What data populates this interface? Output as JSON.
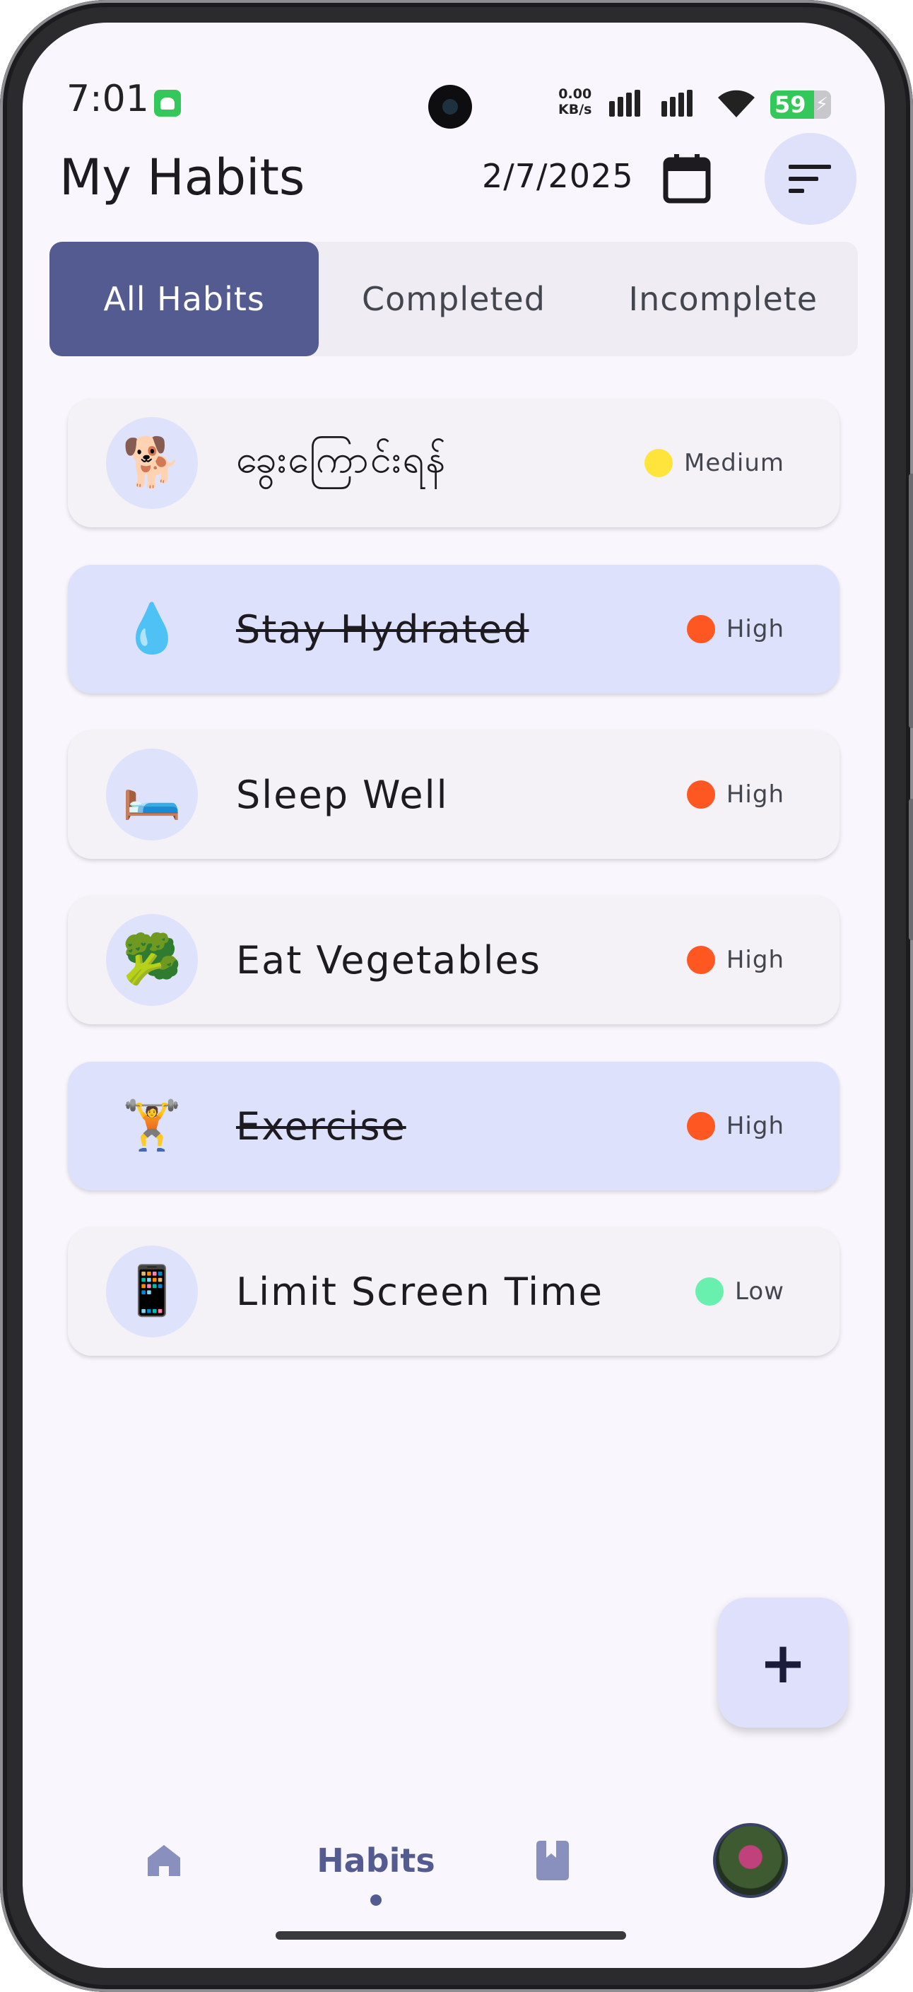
{
  "status_bar": {
    "time": "7:01",
    "net_speed_value": "0.00",
    "net_speed_unit": "KB/s",
    "battery": "59",
    "icons": [
      "android-icon",
      "signal-icon",
      "signal-icon",
      "wifi-icon",
      "battery-charging-icon"
    ]
  },
  "header": {
    "title": "My Habits",
    "date": "2/7/2025",
    "calendar_icon": "calendar-icon",
    "filter_icon": "sort-filter-icon"
  },
  "tabs": [
    {
      "label": "All Habits",
      "active": true
    },
    {
      "label": "Completed",
      "active": false
    },
    {
      "label": "Incomplete",
      "active": false
    }
  ],
  "habits": [
    {
      "icon": "🐕",
      "name": "ခွေးကြောင်းရန်",
      "priority": "Medium",
      "priority_color": "#ffe53b",
      "completed": false
    },
    {
      "icon": "💧",
      "name": "Stay Hydrated",
      "priority": "High",
      "priority_color": "#ff5722",
      "completed": true
    },
    {
      "icon": "🛏️",
      "name": "Sleep Well",
      "priority": "High",
      "priority_color": "#ff5722",
      "completed": false
    },
    {
      "icon": "🥦",
      "name": "Eat Vegetables",
      "priority": "High",
      "priority_color": "#ff5722",
      "completed": false
    },
    {
      "icon": "🏋️",
      "name": "Exercise",
      "priority": "High",
      "priority_color": "#ff5722",
      "completed": true
    },
    {
      "icon": "📱",
      "name": "Limit Screen Time",
      "priority": "Low",
      "priority_color": "#69f0ae",
      "completed": false
    }
  ],
  "fab": {
    "label": "+",
    "icon": "add-icon"
  },
  "bottom_nav": {
    "items": [
      {
        "icon": "home-icon",
        "label": ""
      },
      {
        "icon": "",
        "label": "Habits",
        "active": true
      },
      {
        "icon": "bookmark-book-icon",
        "label": ""
      },
      {
        "icon": "avatar",
        "label": ""
      }
    ]
  },
  "colors": {
    "primary": "#535b91",
    "surface": "#f9f6fd",
    "card": "#f4f1f7",
    "card_completed": "#dde1fb",
    "high": "#ff5722",
    "medium": "#ffe53b",
    "low": "#69f0ae"
  }
}
